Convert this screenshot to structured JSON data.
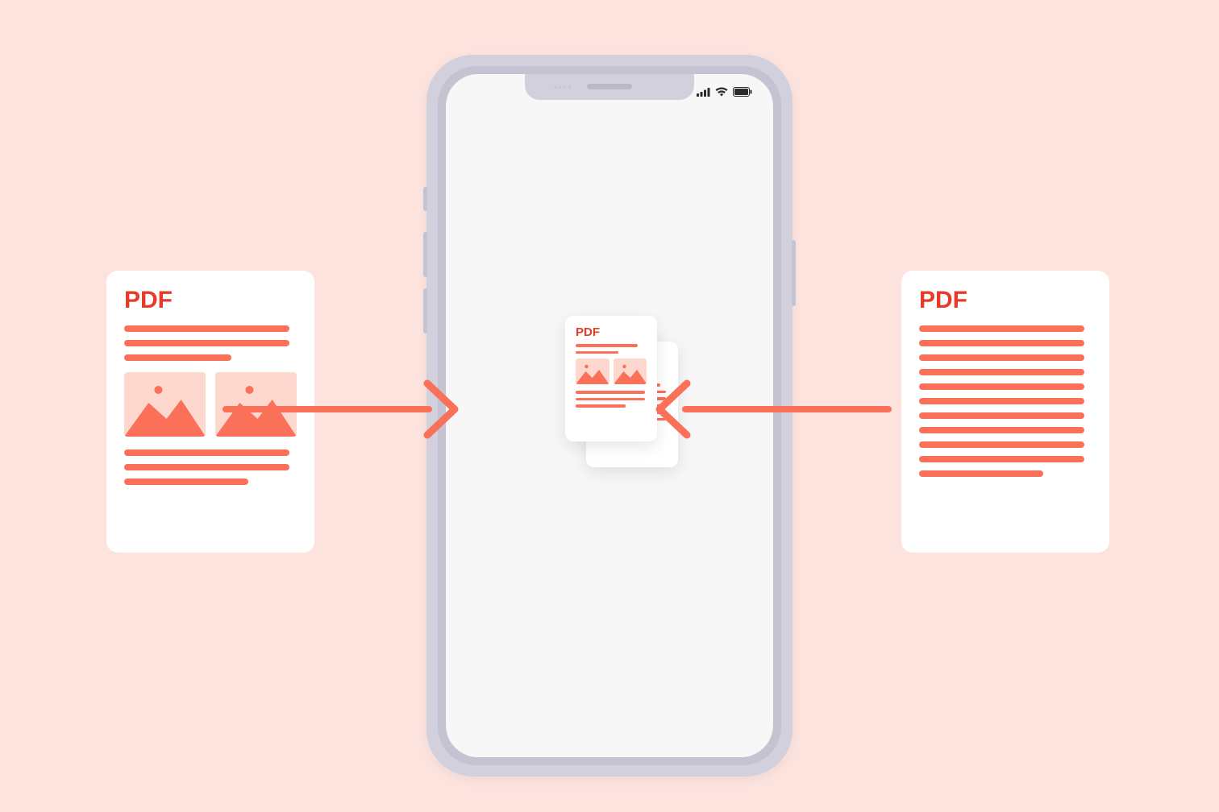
{
  "left_doc": {
    "label": "PDF"
  },
  "right_doc": {
    "label": "PDF"
  },
  "mini_doc": {
    "label": "PDF"
  },
  "colors": {
    "bg": "#fce3de",
    "accent": "#fa7059",
    "accent_dark": "#e63b29",
    "phone_body": "#d1d0dc",
    "phone_bezel": "#c4c3d2",
    "screen": "#f7f7f7",
    "thumb_bg": "#fed8cf"
  }
}
